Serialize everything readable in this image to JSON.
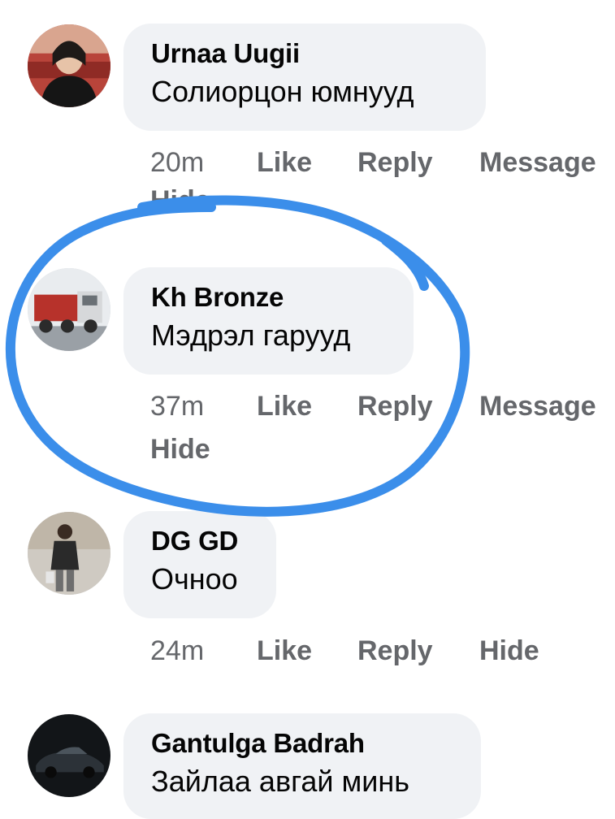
{
  "comments": [
    {
      "author": "Urnaa Uugii",
      "text": "Солиорцон юмнууд",
      "time": "20m",
      "actions": [
        "Like",
        "Reply",
        "Message",
        "Hide"
      ],
      "avatar": "person-avatar"
    },
    {
      "author": "Kh Bronze",
      "text": "Мэдрэл гарууд",
      "time": "37m",
      "actions": [
        "Like",
        "Reply",
        "Message",
        "Hide"
      ],
      "avatar": "truck-avatar"
    },
    {
      "author": "DG GD",
      "text": "Очноо",
      "time": "24m",
      "actions": [
        "Like",
        "Reply",
        "Hide"
      ],
      "avatar": "person-standing-avatar"
    },
    {
      "author": "Gantulga Badrah",
      "text": "Зайлаа авгай минь",
      "avatar": "car-avatar"
    }
  ],
  "colors": {
    "bubble": "#f0f2f5",
    "action_text": "#65676b",
    "name_text": "#050505",
    "annotation": "#3b8eea"
  }
}
